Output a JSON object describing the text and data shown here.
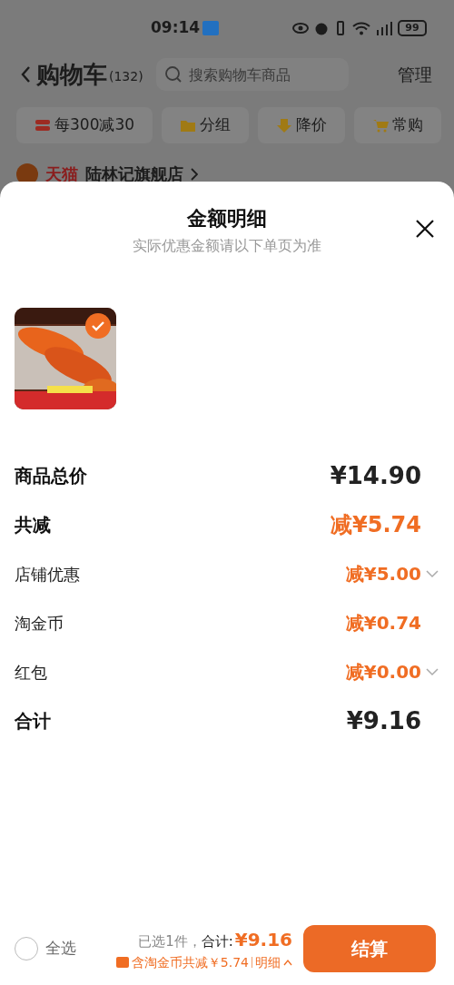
{
  "status_bar": {
    "time": "09:14",
    "battery": "99"
  },
  "header": {
    "title": "购物车",
    "count": "(132)",
    "search_placeholder": "搜索购物车商品",
    "action": "管理"
  },
  "chips": [
    {
      "label": "每300减30",
      "color": "#9c2b22"
    },
    {
      "label": "分组",
      "color": "#a07a14"
    },
    {
      "label": "降价",
      "color": "#a07a14"
    },
    {
      "label": "常购",
      "color": "#a07a14"
    }
  ],
  "shop": {
    "badge": "天猫",
    "name": "陆林记旗舰店"
  },
  "sheet": {
    "title": "金额明细",
    "subtitle": "实际优惠金额请以下单页为准",
    "product": {
      "kind": "picture",
      "checked": true
    },
    "rows": [
      {
        "kind": "total",
        "label": "商品总价",
        "value": "¥14.90",
        "expandable": false
      },
      {
        "kind": "discount",
        "label": "共减",
        "value": "减¥5.74",
        "expandable": false
      },
      {
        "kind": "item",
        "label": "店铺优惠",
        "value": "减¥5.00",
        "expandable": true
      },
      {
        "kind": "item",
        "label": "淘金币",
        "value": "减¥0.74",
        "expandable": false
      },
      {
        "kind": "item",
        "label": "红包",
        "value": "减¥0.00",
        "expandable": true
      },
      {
        "kind": "total",
        "label": "合计",
        "value": "¥9.16",
        "expandable": false
      }
    ]
  },
  "footer": {
    "select_all": {
      "label": "全选",
      "checked": false
    },
    "selected_count": "已选1件，",
    "total_label": "合计:",
    "total": "¥9.16",
    "savings": "含淘金币共减￥5.74",
    "details": "明细",
    "checkout": "结算"
  }
}
